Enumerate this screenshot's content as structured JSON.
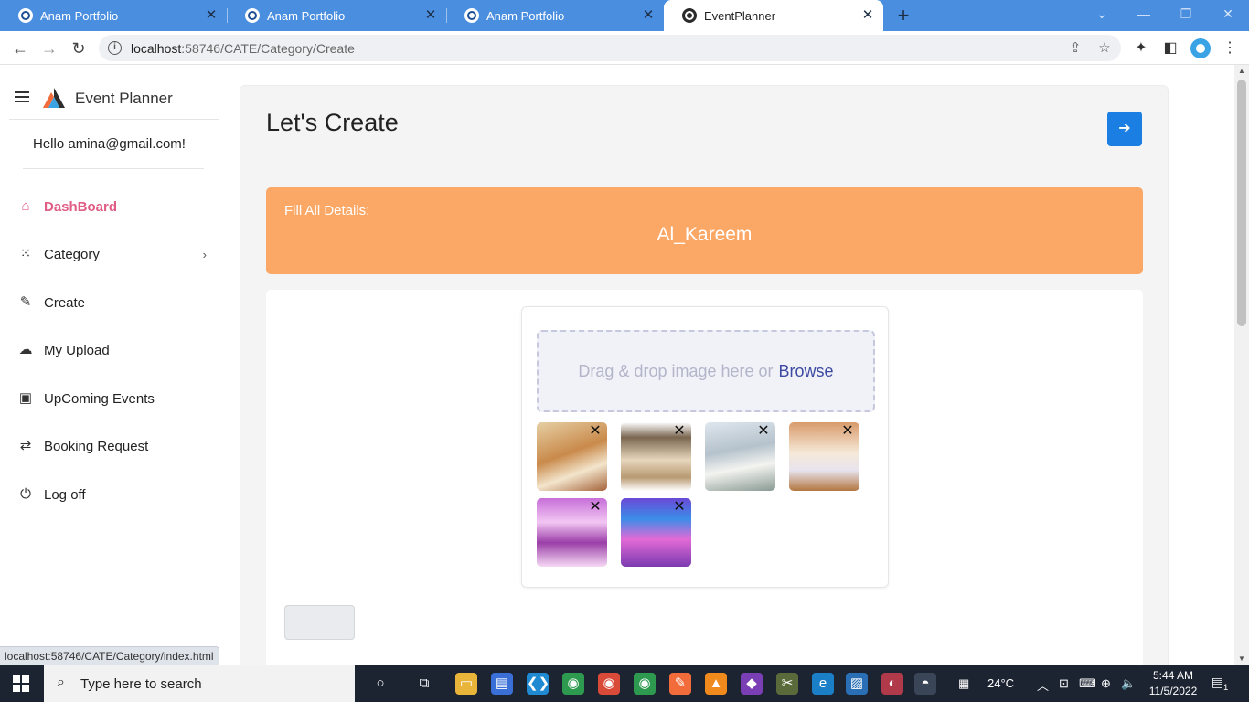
{
  "browser": {
    "tabs": [
      {
        "label": "Anam Portfolio",
        "active": false
      },
      {
        "label": "Anam Portfolio",
        "active": false
      },
      {
        "label": "Anam Portfolio",
        "active": false
      },
      {
        "label": "EventPlanner",
        "active": true
      }
    ],
    "url_host": "localhost",
    "url_rest": ":58746/CATE/Category/Create",
    "status_url": "localhost:58746/CATE/Category/index.html"
  },
  "sidebar": {
    "brand": "Event Planner",
    "greeting": "Hello amina@gmail.com!",
    "items": [
      {
        "label": "DashBoard",
        "icon": "home-icon",
        "active": true
      },
      {
        "label": "Category",
        "icon": "grid-icon",
        "active": false
      },
      {
        "label": "Create",
        "icon": "edit-icon",
        "active": false
      },
      {
        "label": "My Upload",
        "icon": "cloud-upload-icon",
        "active": false
      },
      {
        "label": "UpComing Events",
        "icon": "calendar-icon",
        "active": false
      },
      {
        "label": "Booking Request",
        "icon": "request-icon",
        "active": false
      },
      {
        "label": "Log off",
        "icon": "power-icon",
        "active": false
      }
    ]
  },
  "main": {
    "title": "Let's Create",
    "banner_label": "Fill All Details:",
    "banner_name": "Al_Kareem",
    "dropzone_hint": "Drag & drop image here or",
    "dropzone_browse": "Browse"
  },
  "colors": {
    "accent_blue": "#1a7ee3",
    "banner_orange": "#fba867",
    "active_pink": "#e05d86",
    "tab_bar": "#4a8ee0"
  },
  "taskbar": {
    "search_placeholder": "Type here to search",
    "temperature": "24°C",
    "time": "5:44 AM",
    "date": "11/5/2022",
    "notification_count": "1"
  }
}
